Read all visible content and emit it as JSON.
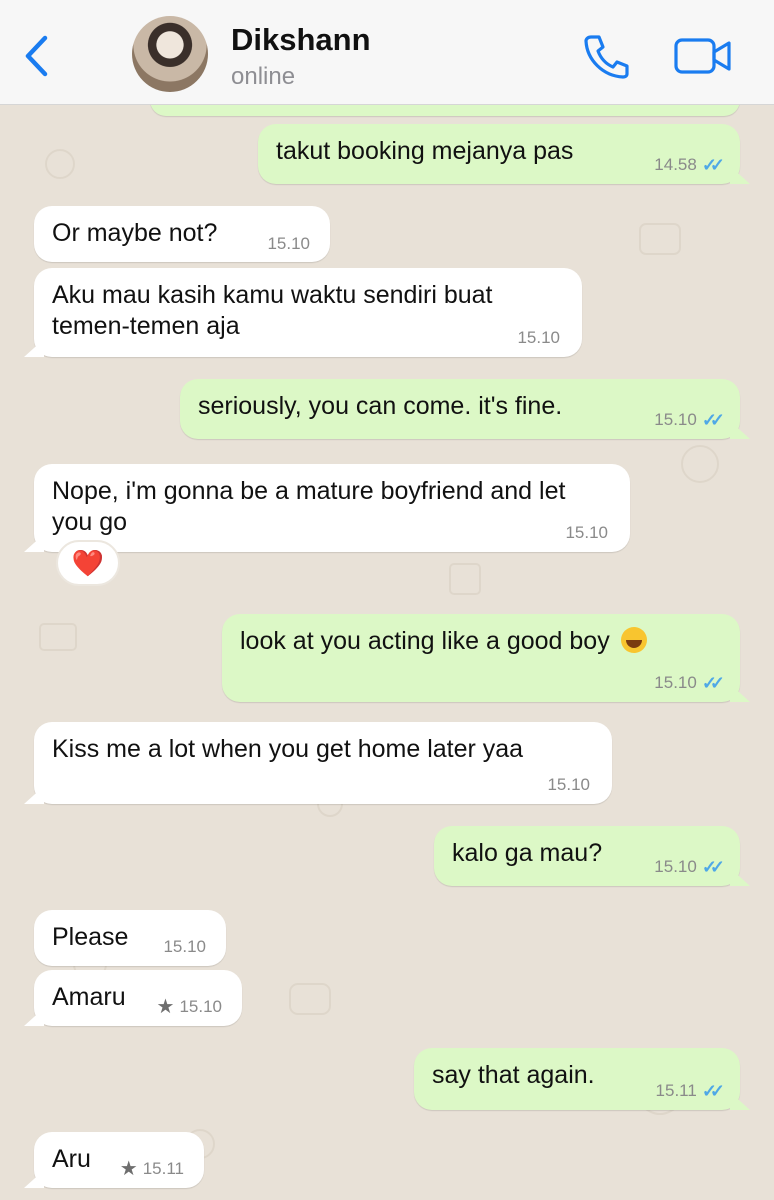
{
  "header": {
    "back_icon": "chevron-left-icon",
    "contact_name": "Dikshann",
    "status": "online",
    "call_icon": "phone-icon",
    "video_icon": "video-camera-icon",
    "accent_color": "#1a7cf0"
  },
  "colors": {
    "incoming_bubble": "#ffffff",
    "outgoing_bubble": "#dcf8c6",
    "read_ticks": "#4fa8e6",
    "wallpaper": "#e8e1d7"
  },
  "messages": [
    {
      "dir": "out",
      "text": "takut booking mejanya pas",
      "time": "14.58",
      "read": true
    },
    {
      "dir": "in",
      "text": "Or maybe not?",
      "time": "15.10"
    },
    {
      "dir": "in",
      "text": "Aku mau kasih kamu waktu sendiri buat temen-temen aja",
      "time": "15.10"
    },
    {
      "dir": "out",
      "text": "seriously, you can come. it's fine.",
      "time": "15.10",
      "read": true
    },
    {
      "dir": "in",
      "text": "Nope, i'm gonna be a mature boyfriend and let you go",
      "time": "15.10",
      "reaction": "❤️"
    },
    {
      "dir": "out",
      "text": "look at you acting like a good boy",
      "emoji": "laughing-tears-emoji",
      "time": "15.10",
      "read": true
    },
    {
      "dir": "in",
      "text": "Kiss me a lot when you get home later yaa",
      "time": "15.10"
    },
    {
      "dir": "out",
      "text": "kalo ga mau?",
      "time": "15.10",
      "read": true
    },
    {
      "dir": "in",
      "text": "Please",
      "time": "15.10"
    },
    {
      "dir": "in",
      "text": "Amaru",
      "time": "15.10",
      "starred": true
    },
    {
      "dir": "out",
      "text": "say that again.",
      "time": "15.11",
      "read": true
    },
    {
      "dir": "in",
      "text": "Aru",
      "time": "15.11",
      "starred": true
    }
  ]
}
